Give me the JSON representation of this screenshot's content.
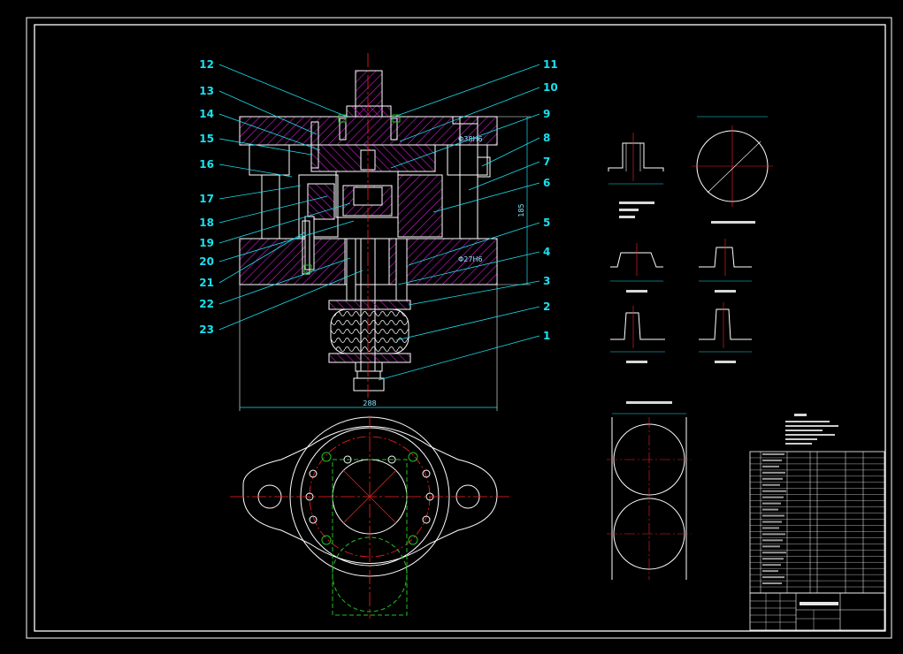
{
  "drawing": {
    "part_numbers": [
      {
        "n": "12"
      },
      {
        "n": "13"
      },
      {
        "n": "14"
      },
      {
        "n": "15"
      },
      {
        "n": "16"
      },
      {
        "n": "17"
      },
      {
        "n": "18"
      },
      {
        "n": "19"
      },
      {
        "n": "20"
      },
      {
        "n": "21"
      },
      {
        "n": "22"
      },
      {
        "n": "23"
      },
      {
        "n": "11"
      },
      {
        "n": "10"
      },
      {
        "n": "9"
      },
      {
        "n": "8"
      },
      {
        "n": "7"
      },
      {
        "n": "6"
      },
      {
        "n": "5"
      },
      {
        "n": "4"
      },
      {
        "n": "3"
      },
      {
        "n": "2"
      },
      {
        "n": "1"
      }
    ],
    "dimensions": {
      "width": "288",
      "height": "185",
      "bore": "Φ38H6",
      "bore2": "Φ27H6"
    },
    "colors": {
      "background": "#000000",
      "outline": "#ffffff",
      "hatch": "#d21ed2",
      "leader": "#19e0ef",
      "centerline": "#ff2020",
      "hidden": "#22c022",
      "label": "#19e0ef"
    }
  }
}
